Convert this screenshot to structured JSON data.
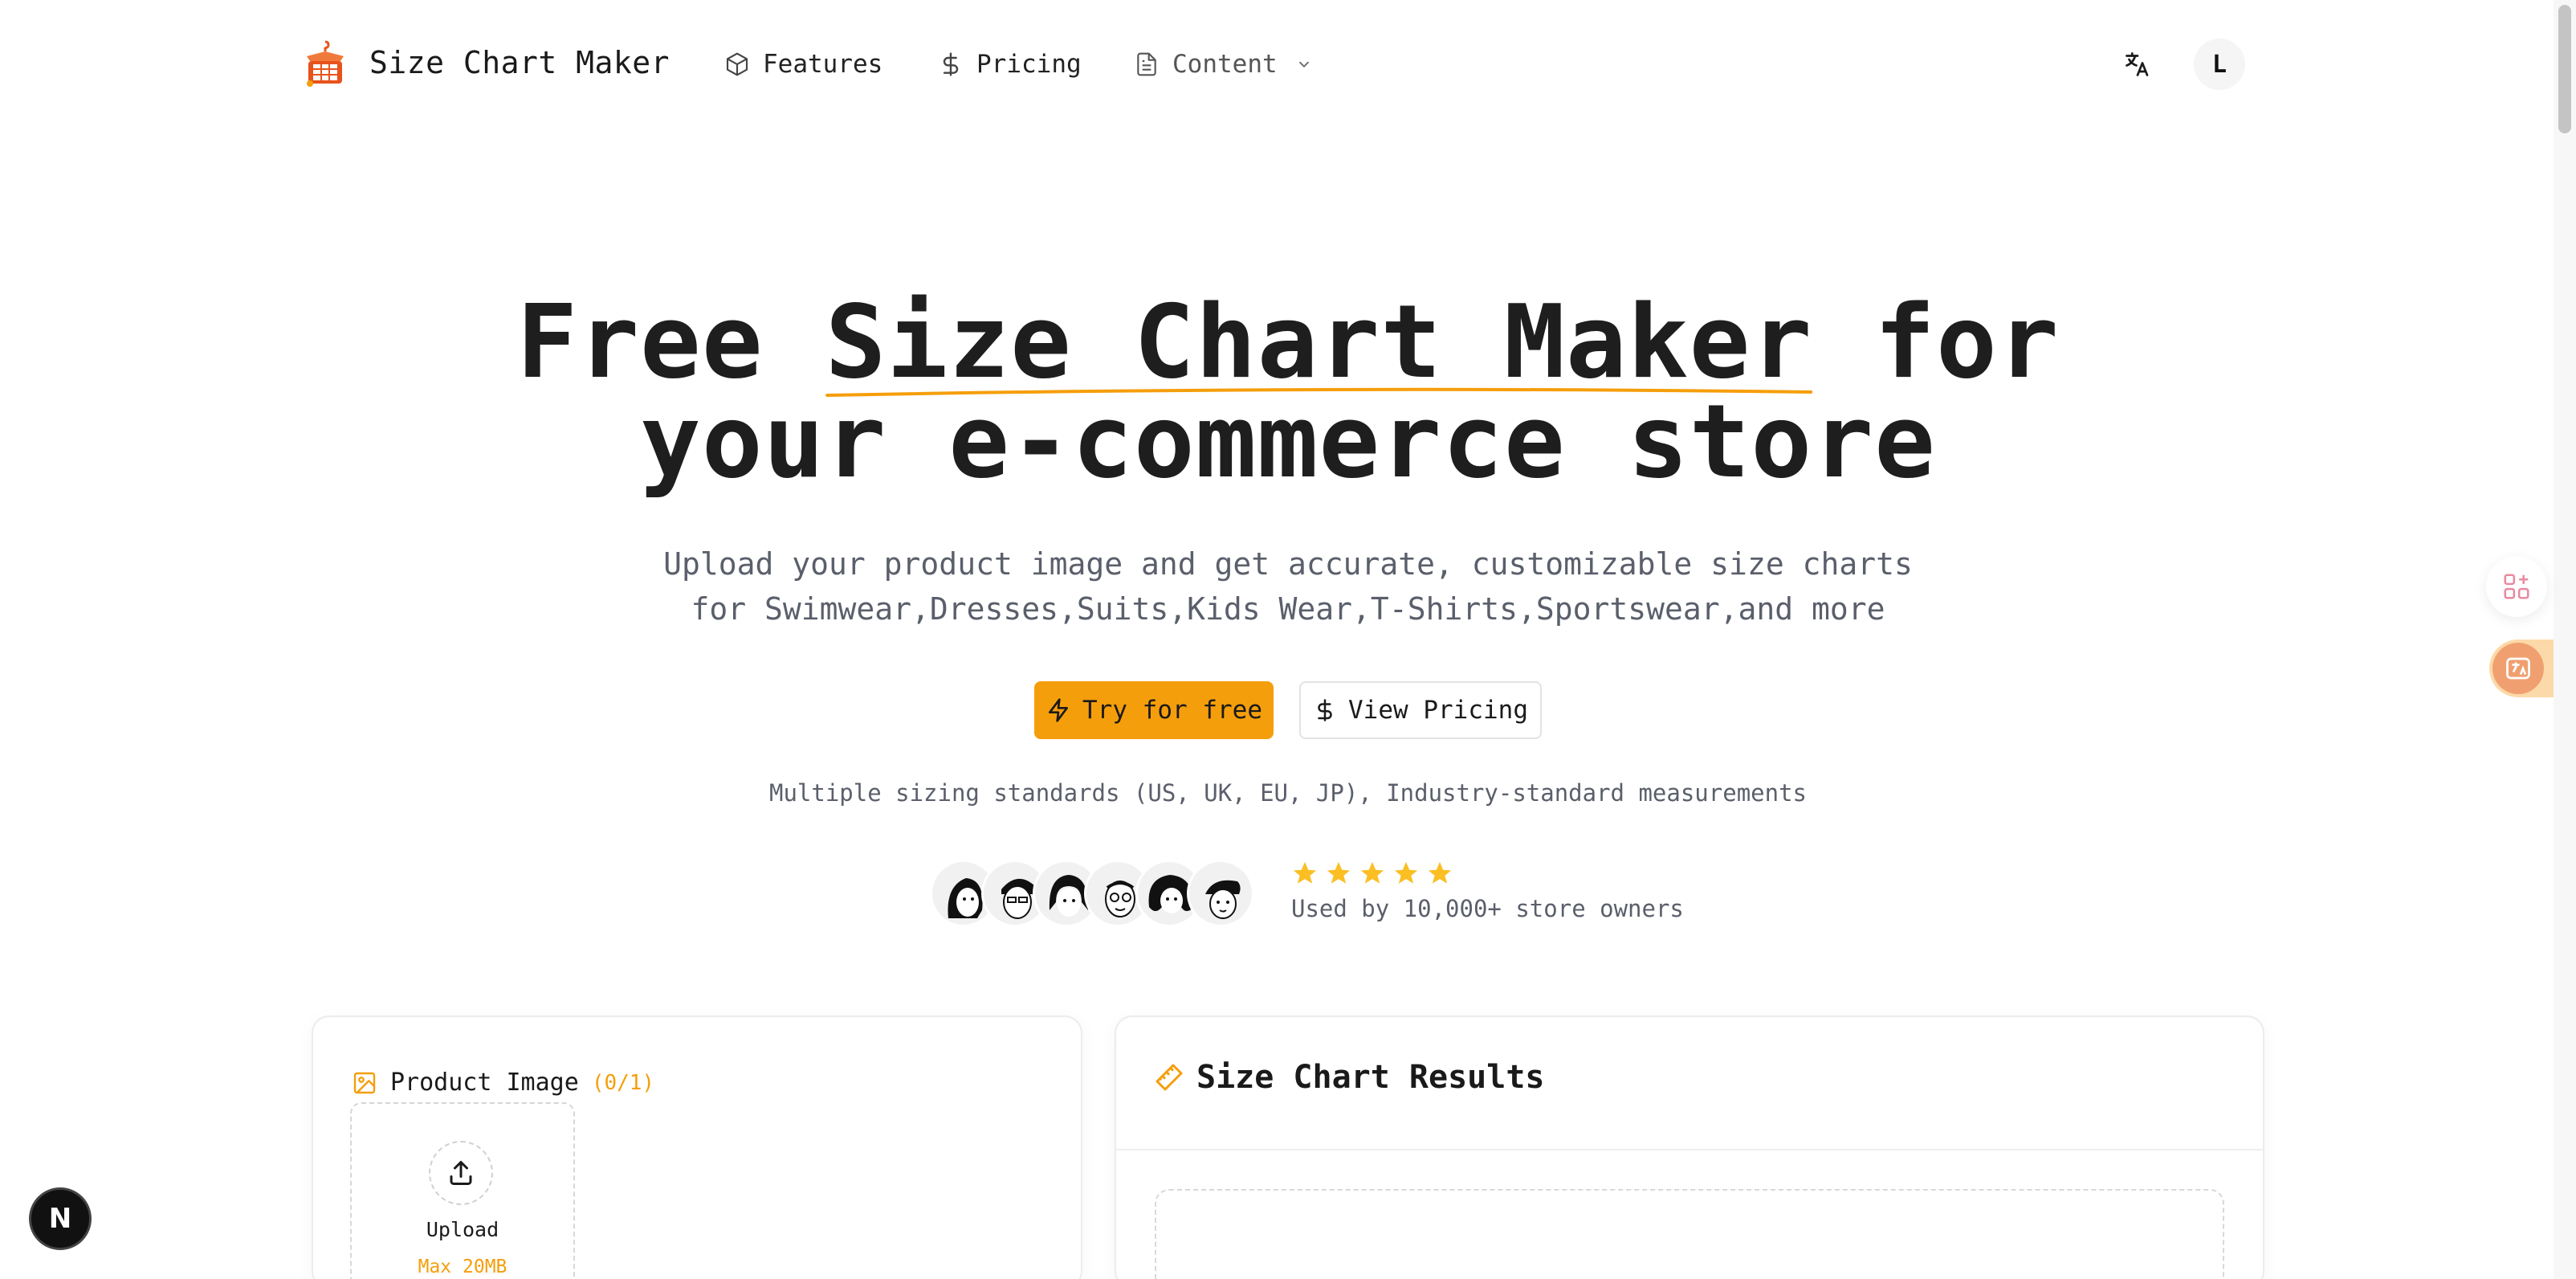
{
  "header": {
    "brand": "Size Chart Maker",
    "nav": [
      {
        "label": "Features",
        "icon": "cube-icon"
      },
      {
        "label": "Pricing",
        "icon": "dollar-icon"
      },
      {
        "label": "Content",
        "icon": "document-icon"
      }
    ],
    "avatar_initial": "L"
  },
  "hero": {
    "title_prefix": "Free ",
    "title_highlight": "Size Chart Maker",
    "title_suffix": " for",
    "title_line2": "your e-commerce store",
    "subtitle_line1": "Upload your product image and get accurate, customizable size charts",
    "subtitle_line2": "for Swimwear,Dresses,Suits,Kids Wear,T-Shirts,Sportswear,and more",
    "cta_primary": "Try for free",
    "cta_secondary": "View Pricing",
    "features_line": "Multiple sizing standards (US, UK, EU, JP), Industry-standard measurements",
    "rating_stars": 5,
    "used_by": "Used by 10,000+ store owners"
  },
  "upload_card": {
    "title": "Product Image",
    "count": "(0/1)",
    "upload_label": "Upload",
    "max_size": "Max 20MB"
  },
  "results_card": {
    "title": "Size Chart Results"
  },
  "badge": {
    "letter": "N"
  },
  "colors": {
    "accent": "#f59e0b",
    "text": "#1e1e1e",
    "muted": "#5a5f6b"
  }
}
